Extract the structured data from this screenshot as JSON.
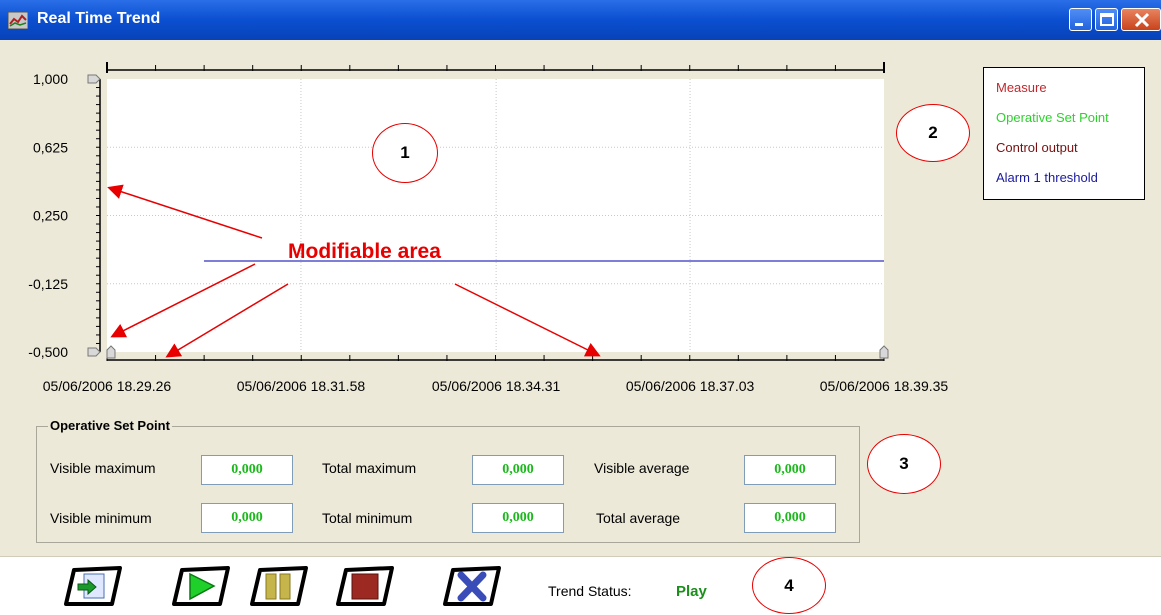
{
  "window": {
    "title": "Real Time Trend"
  },
  "icons": [
    "app-icon",
    "minimize-icon",
    "maximize-icon",
    "close-icon",
    "export-icon",
    "play-icon",
    "pause-icon",
    "stop-icon",
    "delete-icon"
  ],
  "chart_data": {
    "type": "line",
    "ylim": [
      -0.5,
      1.0
    ],
    "y_ticks": [
      "1,000",
      "0,625",
      "0,250",
      "-0,125",
      "-0,500"
    ],
    "x_ticks": [
      "05/06/2006 18.29.26",
      "05/06/2006 18.31.58",
      "05/06/2006 18.34.31",
      "05/06/2006 18.37.03",
      "05/06/2006 18.39.35"
    ],
    "grid": true,
    "series": [
      {
        "name": "Alarm 1 threshold",
        "color": "#3030c0",
        "x": [
          "05/06/2006 18.30.42",
          "05/06/2006 18.39.35"
        ],
        "y": [
          0.0,
          0.0
        ]
      }
    ]
  },
  "legend": {
    "items": [
      {
        "label": "Measure",
        "color": "#c0282d"
      },
      {
        "label": "Operative Set Point",
        "color": "#2fd02f"
      },
      {
        "label": "Control output",
        "color": "#7a1010"
      },
      {
        "label": "Alarm 1 threshold",
        "color": "#1a1aa0"
      }
    ]
  },
  "stats": {
    "title": "Operative Set Point",
    "visible_maximum_label": "Visible maximum",
    "visible_maximum": "0,000",
    "total_maximum_label": "Total maximum",
    "total_maximum": "0,000",
    "visible_average_label": "Visible average",
    "visible_average": "0,000",
    "visible_minimum_label": "Visible minimum",
    "visible_minimum": "0,000",
    "total_minimum_label": "Total minimum",
    "total_minimum": "0,000",
    "total_average_label": "Total average",
    "total_average": "0,000"
  },
  "toolbar": {
    "trend_status_label": "Trend Status:",
    "trend_status_value": "Play"
  },
  "annotations": {
    "modifiable_area": "Modifiable area",
    "markers": [
      "1",
      "2",
      "3",
      "4"
    ]
  }
}
